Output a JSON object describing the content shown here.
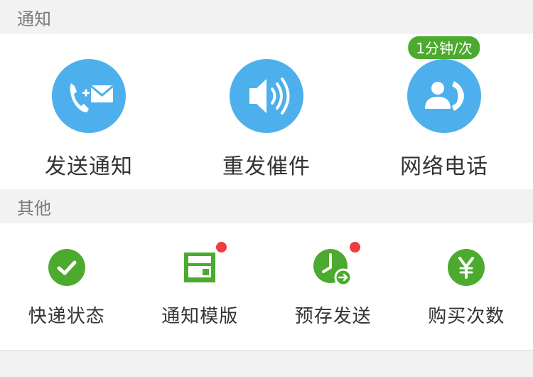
{
  "sections": {
    "notify_title": "通知",
    "other_title": "其他"
  },
  "notify_items": [
    {
      "label": "发送通知",
      "icon": "phone-mail-icon"
    },
    {
      "label": "重发催件",
      "icon": "speaker-icon"
    },
    {
      "label": "网络电话",
      "icon": "contact-phone-icon",
      "badge": "1分钟/次"
    }
  ],
  "other_items": [
    {
      "label": "快递状态",
      "icon": "check-icon"
    },
    {
      "label": "通知模版",
      "icon": "template-icon",
      "dot": true
    },
    {
      "label": "预存发送",
      "icon": "clock-send-icon",
      "dot": true
    },
    {
      "label": "购买次数",
      "icon": "yen-icon"
    }
  ],
  "colors": {
    "blue": "#4db0ec",
    "green": "#4caa2e",
    "red_dot": "#f03c3c",
    "background": "#f2f2f2"
  }
}
